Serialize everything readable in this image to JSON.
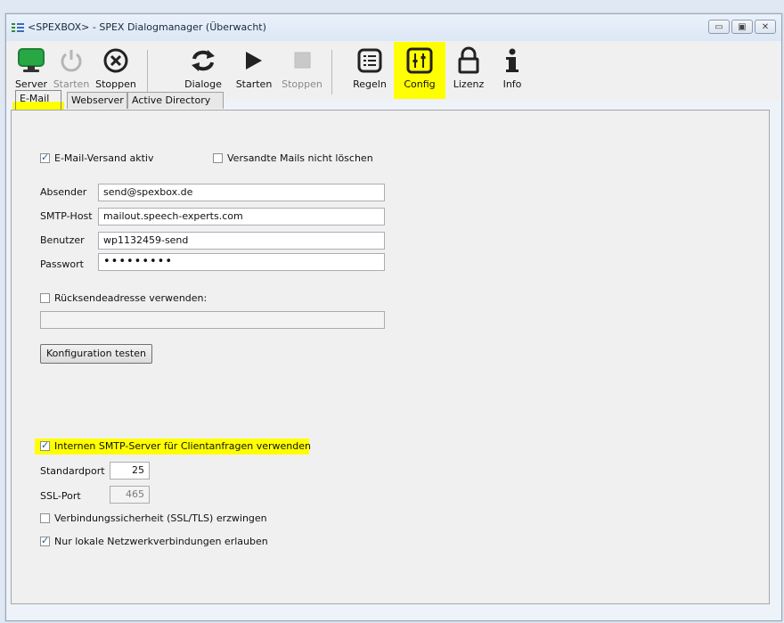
{
  "window": {
    "title": "<SPEXBOX> - SPEX Dialogmanager (Überwacht)"
  },
  "toolbar": {
    "server": "Server",
    "start_server": "Starten",
    "stop_server": "Stoppen",
    "dialogs": "Dialoge",
    "start_dialogs": "Starten",
    "stop_dialogs": "Stoppen",
    "rules": "Regeln",
    "config": "Config",
    "license": "Lizenz",
    "info": "Info"
  },
  "tabs": [
    {
      "label": "E-Mail",
      "active": true
    },
    {
      "label": "Webserver",
      "active": false
    },
    {
      "label": "Active Directory",
      "active": false
    }
  ],
  "email": {
    "send_active": {
      "label": "E-Mail-Versand aktiv",
      "checked": true
    },
    "keep_sent": {
      "label": "Versandte Mails nicht löschen",
      "checked": false
    },
    "sender": {
      "label": "Absender",
      "value": "send@spexbox.de"
    },
    "smtp_host": {
      "label": "SMTP-Host",
      "value": "mailout.speech-experts.com"
    },
    "user": {
      "label": "Benutzer",
      "value": "wp1132459-send"
    },
    "password": {
      "label": "Passwort",
      "value": "•••••••••"
    },
    "reply_to": {
      "label": "Rücksendeadresse verwenden:",
      "checked": false,
      "value": ""
    },
    "test_button": "Konfiguration testen"
  },
  "smtp_server": {
    "internal": {
      "label": "Internen SMTP-Server für Clientanfragen verwenden",
      "checked": true
    },
    "standard_port": {
      "label": "Standardport",
      "value": "25"
    },
    "ssl_port": {
      "label": "SSL-Port",
      "value": "465"
    },
    "force_ssl": {
      "label": "Verbindungssicherheit (SSL/TLS) erzwingen",
      "checked": false
    },
    "local_only": {
      "label": "Nur lokale Netzwerkverbindungen erlauben",
      "checked": true
    }
  },
  "colors": {
    "highlight": "#ffff00",
    "monitor_green": "#27a845"
  }
}
